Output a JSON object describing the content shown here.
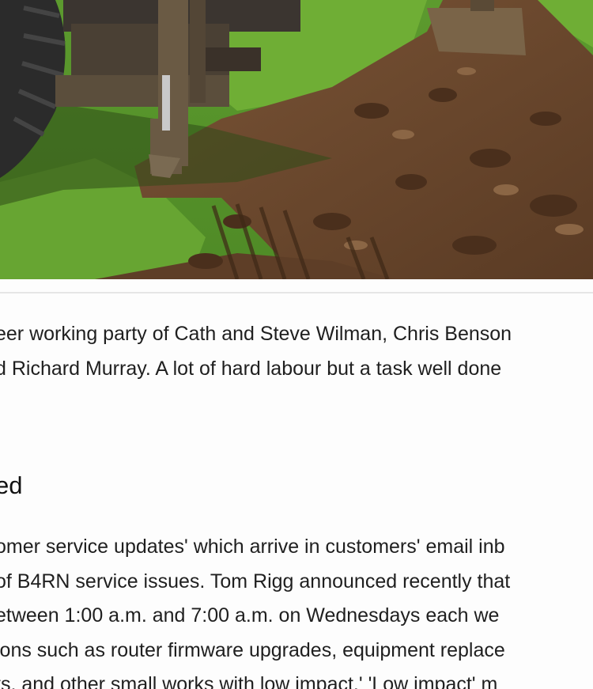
{
  "article": {
    "paragraph_1": [
      "eer working party of Cath and Steve Wilman, Chris Benson",
      "d Richard Murray. A lot of hard labour but a task well done"
    ],
    "heading": "ed",
    "paragraph_2": [
      "omer service updates' which arrive in customers' email inb",
      "of B4RN service issues. Tom Rigg announced recently that",
      "etween 1:00 a.m. and 7:00 a.m. on Wednesdays each we",
      "ions such as router firmware upgrades, equipment replace",
      "ts, and other small works with low impact.' 'Low impact' m"
    ]
  }
}
